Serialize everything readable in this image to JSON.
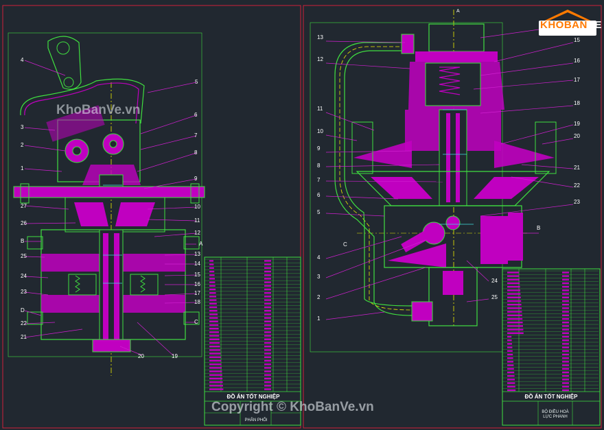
{
  "watermark_top": "KhoBanVe.vn",
  "watermark_bottom": "Copyright © KhoBanVe.vn",
  "logo": {
    "text_orange": "KHOBAN",
    "text_white": "VE"
  },
  "left_drawing": {
    "callouts_left": [
      "4",
      "3",
      "2",
      "1",
      "27",
      "26",
      "B",
      "25",
      "24",
      "23",
      "D",
      "22",
      "21"
    ],
    "callouts_right": [
      "5",
      "6",
      "7",
      "8",
      "9",
      "10",
      "11",
      "12",
      "A",
      "13",
      "14",
      "15",
      "16",
      "17",
      "18",
      "C"
    ],
    "callouts_bottom": [
      "20",
      "19"
    ],
    "title_block": {
      "title": "ĐỒ ÁN TỐT NGHIỆP",
      "subtitle": "PHÂN PHỐI"
    }
  },
  "right_drawing": {
    "top_label": "A",
    "callouts_left": [
      "13",
      "12",
      "11",
      "10",
      "9",
      "8",
      "7",
      "6",
      "5",
      "C",
      "4",
      "3",
      "2",
      "1"
    ],
    "callouts_right": [
      "15",
      "16",
      "17",
      "18",
      "19",
      "20",
      "21",
      "22",
      "23",
      "B",
      "24",
      "25"
    ],
    "title_block": {
      "title": "ĐỒ ÁN TỐT NGHIỆP",
      "subtitle_line1": "BỘ ĐIỀU HOÀ",
      "subtitle_line2": "LỰC PHANH"
    }
  },
  "colors": {
    "background": "#212830",
    "border": "#d0203a",
    "section": "#c000c0",
    "outline": "#40e040",
    "leader": "#d020d0",
    "centerline": "#f0f000",
    "dimension": "#40e0e0"
  }
}
